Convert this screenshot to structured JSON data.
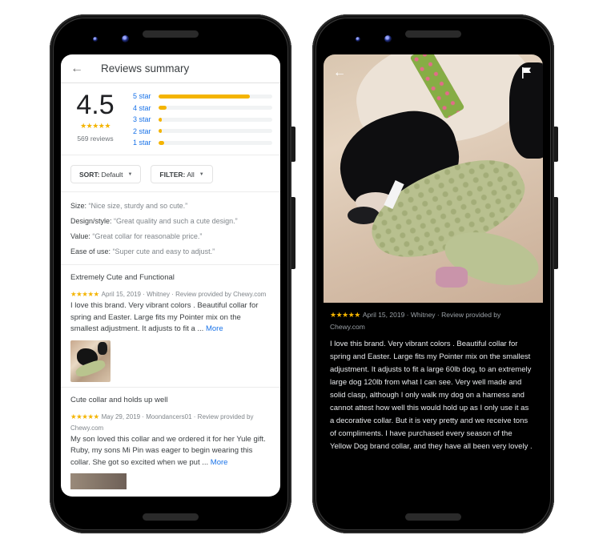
{
  "colors": {
    "accent_blue": "#1a73e8",
    "star_yellow": "#f4b400",
    "text_primary": "#3c4043",
    "text_secondary": "#80868b"
  },
  "left_screen": {
    "appbar": {
      "back_icon": "arrow-left",
      "title": "Reviews summary"
    },
    "rating": {
      "score": "4.5",
      "stars": "★★★★★",
      "stars_value": 4.5,
      "count_label": "569 reviews"
    },
    "histogram": [
      {
        "label": "5 star",
        "fraction": 0.8
      },
      {
        "label": "4 star",
        "fraction": 0.07
      },
      {
        "label": "3 star",
        "fraction": 0.03
      },
      {
        "label": "2 star",
        "fraction": 0.01
      },
      {
        "label": "1 star",
        "fraction": 0.05
      }
    ],
    "filters": {
      "sort_key": "SORT:",
      "sort_value": "Default",
      "filter_key": "FILTER:",
      "filter_value": "All",
      "caret_icon": "▼"
    },
    "aspects": [
      {
        "key": "Size:",
        "quote": "“Nice size, sturdy and so cute.”"
      },
      {
        "key": "Design/style:",
        "quote": "“Great quality and such a cute design.”"
      },
      {
        "key": "Value:",
        "quote": "“Great collar for reasonable price.”"
      },
      {
        "key": "Ease of use:",
        "quote": "“Super cute and easy to adjust.”"
      }
    ],
    "reviews": [
      {
        "title": "Extremely Cute and Functional",
        "stars": "★★★★★",
        "meta": "April 15, 2019 · Whitney · Review provided by Chewy.com",
        "body": "I love this brand. Very vibrant colors . Beautiful collar for spring and Easter. Large fits my Pointer mix on the smallest adjustment. It adjusts to fit a ... ",
        "more_label": "More"
      },
      {
        "title": "Cute collar and holds up well",
        "stars": "★★★★★",
        "meta": "May 29, 2019 · Moondancers01 · Review provided by Chewy.com",
        "body": "My son loved this collar and we ordered it for her Yule gift. Ruby, my sons Mi Pin was eager to begin wearing this collar. She got so excited when we put ... ",
        "more_label": "More"
      }
    ]
  },
  "right_screen": {
    "back_icon": "arrow-left",
    "flag_icon": "flag",
    "review": {
      "stars": "★★★★★",
      "meta": "April 15, 2019 · Whitney · Review provided by Chewy.com",
      "body": "I love this brand. Very vibrant colors . Beautiful collar for spring and Easter. Large fits my Pointer mix on the smallest adjustment. It adjusts to fit a large 60lb dog, to an extremely large dog 120lb from what I can see. Very well made and solid clasp, although I only walk my dog on a harness and cannot attest how well this would hold up as I only use it as a decorative collar. But it is very pretty and we receive tons of compliments. I have purchased every season of the Yellow Dog brand collar, and they have all been very lovely ."
    }
  }
}
